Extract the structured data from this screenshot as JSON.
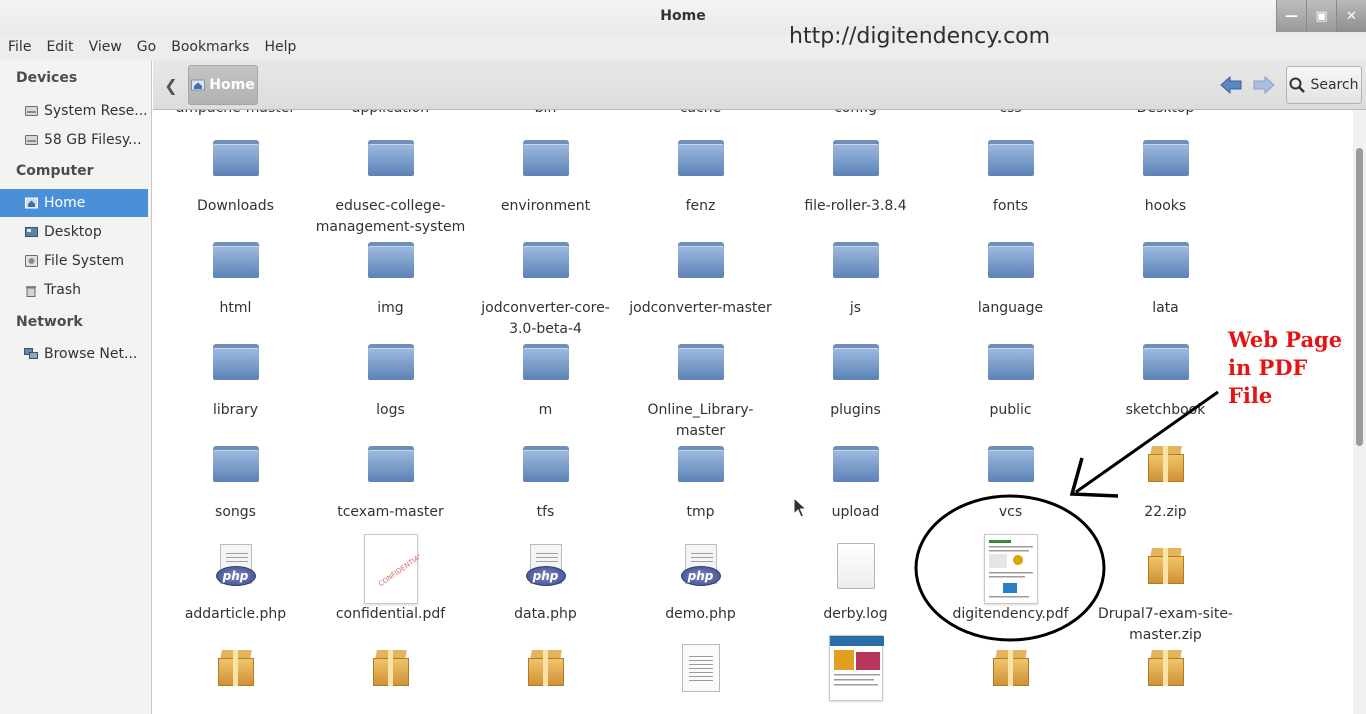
{
  "window": {
    "title": "Home"
  },
  "menubar": {
    "items": [
      "File",
      "Edit",
      "View",
      "Go",
      "Bookmarks",
      "Help"
    ]
  },
  "watermark": "http://digitendency.com",
  "sidebar": {
    "sections": [
      {
        "header": "Devices",
        "items": [
          {
            "label": "System Rese...",
            "icon": "drive-icon"
          },
          {
            "label": "58 GB Filesy...",
            "icon": "drive-icon"
          }
        ]
      },
      {
        "header": "Computer",
        "items": [
          {
            "label": "Home",
            "icon": "home-icon",
            "selected": true
          },
          {
            "label": "Desktop",
            "icon": "desktop-icon"
          },
          {
            "label": "File System",
            "icon": "filesystem-icon"
          },
          {
            "label": "Trash",
            "icon": "trash-icon"
          }
        ]
      },
      {
        "header": "Network",
        "items": [
          {
            "label": "Browse Net...",
            "icon": "network-icon"
          }
        ]
      }
    ]
  },
  "toolbar": {
    "path_label": "Home",
    "search_label": "Search"
  },
  "partial_top_row": [
    "ampache-master",
    "application",
    "bin",
    "cache",
    "config",
    "css",
    "Desktop"
  ],
  "files": [
    {
      "name": "Downloads",
      "type": "folder"
    },
    {
      "name": "edusec-college-management-system",
      "type": "folder"
    },
    {
      "name": "environment",
      "type": "folder"
    },
    {
      "name": "fenz",
      "type": "folder"
    },
    {
      "name": "file-roller-3.8.4",
      "type": "folder"
    },
    {
      "name": "fonts",
      "type": "folder"
    },
    {
      "name": "hooks",
      "type": "folder"
    },
    {
      "name": "html",
      "type": "folder"
    },
    {
      "name": "img",
      "type": "folder"
    },
    {
      "name": "jodconverter-core-3.0-beta-4",
      "type": "folder"
    },
    {
      "name": "jodconverter-master",
      "type": "folder"
    },
    {
      "name": "js",
      "type": "folder"
    },
    {
      "name": "language",
      "type": "folder"
    },
    {
      "name": "lata",
      "type": "folder"
    },
    {
      "name": "library",
      "type": "folder"
    },
    {
      "name": "logs",
      "type": "folder"
    },
    {
      "name": "m",
      "type": "folder"
    },
    {
      "name": "Online_Library-master",
      "type": "folder"
    },
    {
      "name": "plugins",
      "type": "folder"
    },
    {
      "name": "public",
      "type": "folder"
    },
    {
      "name": "sketchbook",
      "type": "folder"
    },
    {
      "name": "songs",
      "type": "folder"
    },
    {
      "name": "tcexam-master",
      "type": "folder"
    },
    {
      "name": "tfs",
      "type": "folder"
    },
    {
      "name": "tmp",
      "type": "folder"
    },
    {
      "name": "upload",
      "type": "folder"
    },
    {
      "name": "vcs",
      "type": "folder"
    },
    {
      "name": "22.zip",
      "type": "zip"
    },
    {
      "name": "addarticle.php",
      "type": "php"
    },
    {
      "name": "confidential.pdf",
      "type": "pdf-confidential"
    },
    {
      "name": "data.php",
      "type": "php"
    },
    {
      "name": "demo.php",
      "type": "php"
    },
    {
      "name": "derby.log",
      "type": "log"
    },
    {
      "name": "digitendency.pdf",
      "type": "pdf-web"
    },
    {
      "name": "Drupal7-exam-site-master.zip",
      "type": "zip"
    },
    {
      "name": "",
      "type": "zip"
    },
    {
      "name": "",
      "type": "zip"
    },
    {
      "name": "",
      "type": "zip"
    },
    {
      "name": "",
      "type": "text"
    },
    {
      "name": "",
      "type": "image"
    },
    {
      "name": "",
      "type": "zip"
    },
    {
      "name": "",
      "type": "zip"
    }
  ],
  "annotation": {
    "text": "Web Page in PDF File",
    "color": "#e51414"
  },
  "colors": {
    "selection": "#4a90d9",
    "folder": "#7398c9",
    "annotation": "#e51414"
  }
}
